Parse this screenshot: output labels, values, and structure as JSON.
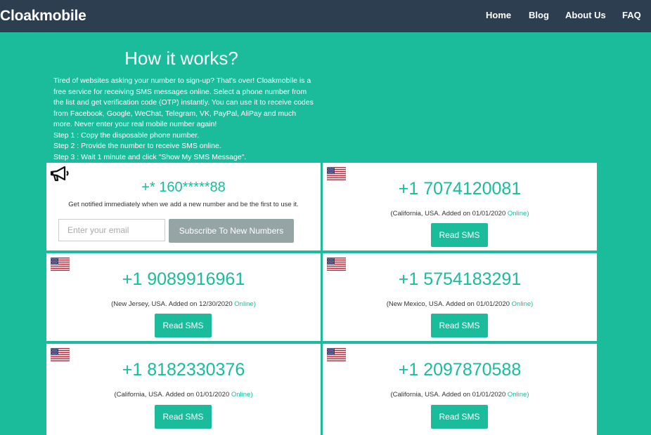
{
  "navbar": {
    "brand": "Cloakmobile",
    "links": [
      "Home",
      "Blog",
      "About Us",
      "FAQ"
    ]
  },
  "hero": {
    "title": "How it works?",
    "description": "Tired of websites asking your number to sign-up? That's over! Cloakmobile is a free service for receiving SMS messages online. Select a phone number from the list and get verification code (OTP) instantly. You can use it to receive codes from Facebook, Google, WeChat, Telegram, VK, PayPal, AliPay and much more. Never enter your real mobile number again!",
    "steps": [
      "Step 1 : Copy the disposable phone number.",
      "Step 2 : Provide the number to receive SMS online.",
      "Step 3 : Wait 1 minute and click \"Show My SMS Message\"."
    ]
  },
  "subscribe": {
    "masked_number": "+* 160*****88",
    "notice": "Get notified immediately when we add a new number and be the first to use it.",
    "email_placeholder": "Enter your email",
    "button_label": "Subscribe To New Numbers"
  },
  "numbers": [
    {
      "number": "+1 7074120081",
      "location": "(California, USA. Added on 01/01/2020",
      "status": "Online)",
      "button": "Read SMS"
    },
    {
      "number": "+1 9089916961",
      "location": "(New Jersey, USA. Added on 12/30/2020",
      "status": "Online)",
      "button": "Read SMS"
    },
    {
      "number": "+1 5754183291",
      "location": "(New Mexico, USA. Added on 01/01/2020",
      "status": "Online)",
      "button": "Read SMS"
    },
    {
      "number": "+1 8182330376",
      "location": "(California, USA. Added on 01/01/2020",
      "status": "Online)",
      "button": "Read SMS"
    },
    {
      "number": "+1 2097870588",
      "location": "(California, USA. Added on 01/01/2020",
      "status": "Online)",
      "button": "Read SMS"
    }
  ],
  "colors": {
    "accent": "#1abc9c",
    "navbar": "#2c3e50",
    "subscribe_button": "#95a5a6"
  },
  "icons": {
    "megaphone": "megaphone-icon",
    "flag": "us-flag-icon"
  }
}
